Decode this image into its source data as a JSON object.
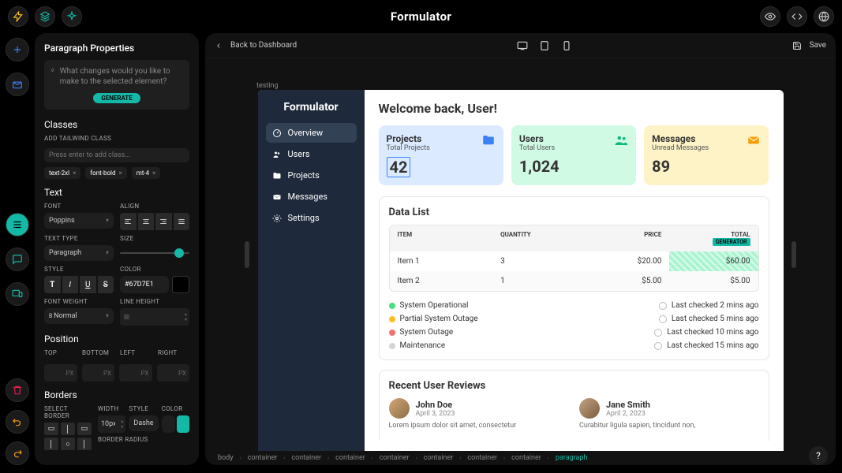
{
  "app_title": "Formulator",
  "toolbar": {
    "back": "Back to Dashboard",
    "save": "Save"
  },
  "panel": {
    "title": "Paragraph Properties",
    "ai_prompt": "What changes would you like to make to the selected element?",
    "generate": "GENERATE",
    "classes_title": "Classes",
    "add_class_label": "ADD TAILWIND CLASS",
    "add_class_placeholder": "Press enter to add class...",
    "chips": [
      "text-2xl",
      "font-bold",
      "mt-4"
    ],
    "text_title": "Text",
    "font_label": "FONT",
    "font_value": "Poppins",
    "align_label": "ALIGN",
    "text_type_label": "TEXT TYPE",
    "text_type_value": "Paragraph",
    "size_label": "SIZE",
    "style_label": "STYLE",
    "color_label": "COLOR",
    "color_value": "#67D7E1",
    "font_weight_label": "FONT WEIGHT",
    "font_weight_value": "Normal",
    "line_height_label": "LINE HEIGHT",
    "position_title": "Position",
    "top": "TOP",
    "bottom": "BOTTOM",
    "left": "LEFT",
    "right": "RIGHT",
    "px": "PX",
    "borders_title": "Borders",
    "select_border": "SELECT BORDER",
    "width_label": "WIDTH",
    "width_value": "10px",
    "border_style_label": "STYLE",
    "border_style_value": "Dashe",
    "border_color_label": "COLOR",
    "border_radius_label": "BORDER RADIUS"
  },
  "testing_label": "testing",
  "preview": {
    "brand": "Formulator",
    "nav": [
      "Overview",
      "Users",
      "Projects",
      "Messages",
      "Settings"
    ],
    "welcome": "Welcome back, User!",
    "cards": [
      {
        "title": "Projects",
        "sub": "Total Projects",
        "num": "42"
      },
      {
        "title": "Users",
        "sub": "Total Users",
        "num": "1,024"
      },
      {
        "title": "Messages",
        "sub": "Unread Messages",
        "num": "89"
      }
    ],
    "datalist_title": "Data List",
    "table_headers": {
      "item": "ITEM",
      "qty": "QUANTITY",
      "price": "PRICE",
      "total": "TOTAL",
      "generator": "GENERATOR"
    },
    "table_rows": [
      {
        "item": "Item 1",
        "qty": "3",
        "price": "$20.00",
        "total": "$60.00"
      },
      {
        "item": "Item 2",
        "qty": "1",
        "price": "$5.00",
        "total": "$5.00"
      }
    ],
    "statuses": [
      {
        "label": "System Operational",
        "color": "#4ade80",
        "time": "Last checked 2 mins ago"
      },
      {
        "label": "Partial System Outage",
        "color": "#fbbf24",
        "time": "Last checked 5 mins ago"
      },
      {
        "label": "System Outage",
        "color": "#f87171",
        "time": "Last checked 10 mins ago"
      },
      {
        "label": "Maintenance",
        "color": "#d4d4d4",
        "time": "Last checked 15 mins ago"
      }
    ],
    "reviews_title": "Recent User Reviews",
    "reviews": [
      {
        "name": "John Doe",
        "date": "April 3, 2023",
        "text": "Lorem ipsum dolor sit amet, consectetur"
      },
      {
        "name": "Jane Smith",
        "date": "April 2, 2023",
        "text": "Curabitur ligula sapien, tincidunt non,"
      }
    ]
  },
  "breadcrumb": [
    "body",
    "container",
    "container",
    "container",
    "container",
    "container",
    "container",
    "container",
    "paragraph"
  ],
  "help": "?"
}
